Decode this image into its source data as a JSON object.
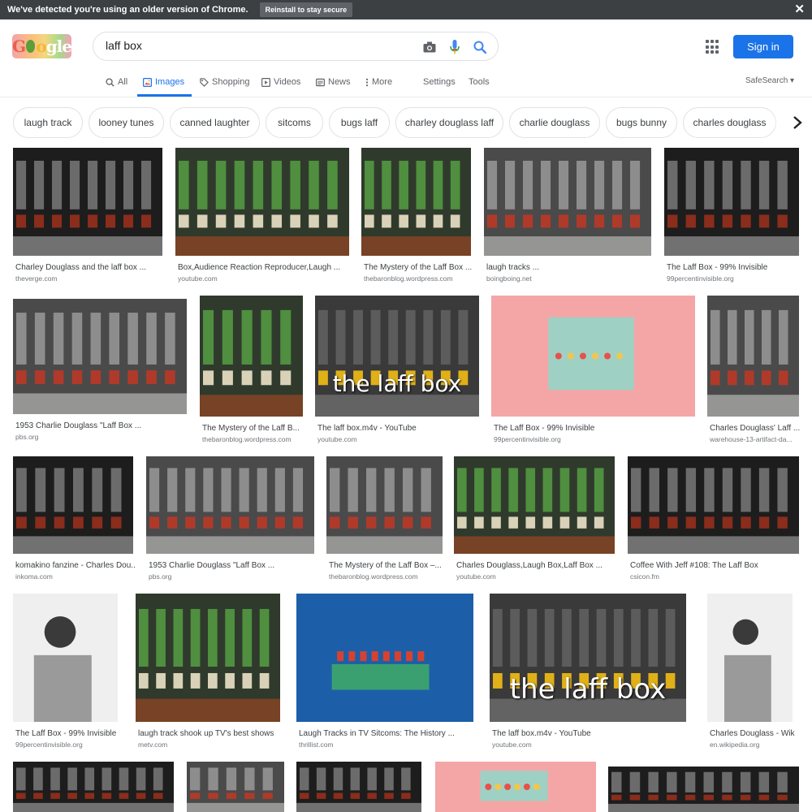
{
  "banner": {
    "message": "We've detected you're using an older version of Chrome.",
    "button_label": "Reinstall to stay secure",
    "close_glyph": "✕"
  },
  "search": {
    "query": "laff box"
  },
  "header": {
    "sign_in": "Sign in",
    "logo_text": "Google"
  },
  "tabs": {
    "all": "All",
    "images": "Images",
    "shopping": "Shopping",
    "videos": "Videos",
    "news": "News",
    "more": "More",
    "settings": "Settings",
    "tools": "Tools",
    "safesearch": "SafeSearch"
  },
  "chips": [
    "laugh track",
    "looney tunes",
    "canned laughter",
    "sitcoms",
    "bugs laff",
    "charley douglass laff",
    "charlie douglass",
    "bugs bunny",
    "charles douglass"
  ],
  "results": [
    {
      "title": "Charley Douglass and the laff box ...",
      "source": "theverge.com"
    },
    {
      "title": "Box,Audience Reaction Reproducer,Laugh ...",
      "source": "youtube.com"
    },
    {
      "title": "The Mystery of the Laff Box ...",
      "source": "thebaronblog.wordpress.com"
    },
    {
      "title": "laugh tracks ...",
      "source": "boingboing.net"
    },
    {
      "title": "The Laff Box - 99% Invisible",
      "source": "99percentinvisible.org"
    },
    {
      "title": "1953 Charlie Douglass \"Laff Box ...",
      "source": "pbs.org"
    },
    {
      "title": "The Mystery of the Laff B...",
      "source": "thebaronblog.wordpress.com"
    },
    {
      "title": "The laff box.m4v - YouTube",
      "source": "youtube.com",
      "overlay": "the laff box"
    },
    {
      "title": "The Laff Box - 99% Invisible",
      "source": "99percentinvisible.org"
    },
    {
      "title": "Charles Douglass' Laff ...",
      "source": "warehouse-13-artifact-da..."
    },
    {
      "title": "komakino fanzine - Charles Dou...",
      "source": "inkoma.com"
    },
    {
      "title": "1953 Charlie Douglass \"Laff Box ...",
      "source": "pbs.org"
    },
    {
      "title": "The Mystery of the Laff Box –...",
      "source": "thebaronblog.wordpress.com"
    },
    {
      "title": "Charles Douglass,Laugh Box,Laff Box ...",
      "source": "youtube.com"
    },
    {
      "title": "Coffee With Jeff #108: The Laff Box",
      "source": "csicon.fm"
    },
    {
      "title": "The Laff Box - 99% Invisible",
      "source": "99percentinvisible.org"
    },
    {
      "title": "laugh track shook up TV's best shows",
      "source": "metv.com"
    },
    {
      "title": "Laugh Tracks in TV Sitcoms: The History ...",
      "source": "thrillist.com"
    },
    {
      "title": "The laff box.m4v - YouTube",
      "source": "youtube.com",
      "overlay": "the laff box"
    },
    {
      "title": "Charles Douglass - Wikip...",
      "source": "en.wikipedia.org"
    }
  ]
}
